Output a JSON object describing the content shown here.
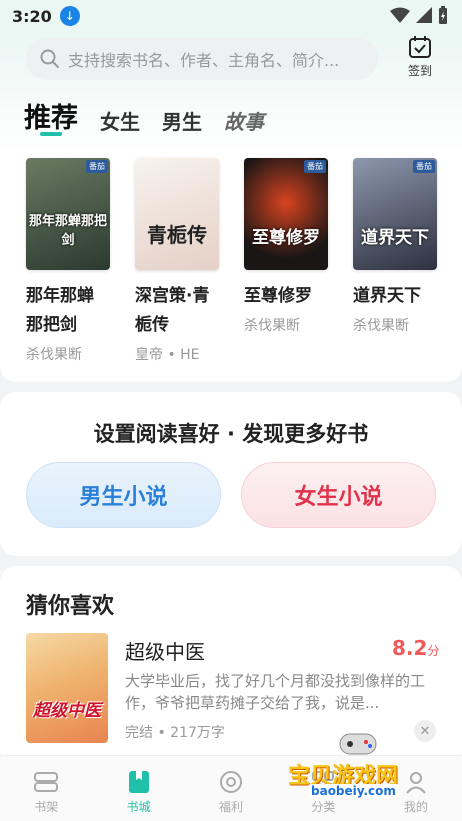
{
  "status": {
    "time": "3:20"
  },
  "search": {
    "placeholder": "支持搜索书名、作者、主角名、简介..."
  },
  "checkin": {
    "label": "签到"
  },
  "tabs": [
    {
      "label": "推荐",
      "active": true
    },
    {
      "label": "女生"
    },
    {
      "label": "男生"
    },
    {
      "label": "故事"
    }
  ],
  "recommend": [
    {
      "title": "那年那蝉那把剑",
      "author": "杀伐果断",
      "cover_text": "那年那蝉那把剑",
      "colors": [
        "#2b3a2f",
        "#6a7a62"
      ]
    },
    {
      "title": "深宫策·青栀传",
      "author": "皇帝 • HE",
      "cover_text": "青栀传",
      "colors": [
        "#f4f0ea",
        "#e9d9cf"
      ]
    },
    {
      "title": "至尊修罗",
      "author": "杀伐果断",
      "cover_text": "至尊修罗",
      "colors": [
        "#1a1616",
        "#b9281d"
      ]
    },
    {
      "title": "道界天下",
      "author": "杀伐果断",
      "cover_text": "道界天下",
      "colors": [
        "#2d3140",
        "#8e97ad"
      ]
    }
  ],
  "preference": {
    "title": "设置阅读喜好 · 发现更多好书",
    "male_label": "男生小说",
    "female_label": "女生小说"
  },
  "guess": {
    "title": "猜你喜欢",
    "book": {
      "name": "超级中医",
      "score": "8.2",
      "score_unit": "分",
      "cover_text": "超级中医",
      "description": "大学毕业后，找了好几个月都没找到像样的工作，爷爷把草药摊子交给了我，说是...",
      "meta": "完结 • 217万字"
    }
  },
  "bottom_nav": [
    {
      "label": "书架"
    },
    {
      "label": "书城",
      "active": true
    },
    {
      "label": "福利"
    },
    {
      "label": "分类"
    },
    {
      "label": "我的"
    }
  ],
  "watermark": {
    "title": "宝贝游戏网",
    "url": "baobeiy.com"
  },
  "colors": {
    "accent": "#21c0a8",
    "male": "#2a7fd8",
    "female": "#e0334b",
    "score": "#f05a5a"
  }
}
